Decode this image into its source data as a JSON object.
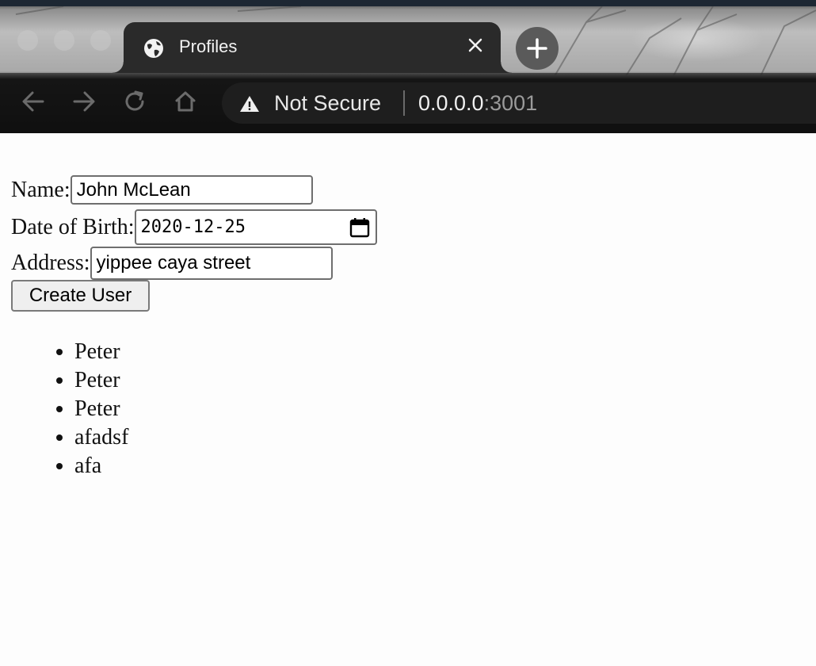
{
  "browser": {
    "tab": {
      "title": "Profiles",
      "icon": "globe-icon"
    },
    "new_tab_icon": "plus-icon",
    "security_label": "Not Secure",
    "url": {
      "host": "0.0.0.0",
      "port": ":3001"
    }
  },
  "form": {
    "name": {
      "label": "Name:",
      "value": "John McLean"
    },
    "dob": {
      "label": "Date of Birth:",
      "value": "2020-12-25"
    },
    "address": {
      "label": "Address:",
      "value": "yippee caya street"
    },
    "submit_label": "Create User"
  },
  "users": [
    "Peter",
    "Peter",
    "Peter",
    "afadsf",
    "afa"
  ]
}
